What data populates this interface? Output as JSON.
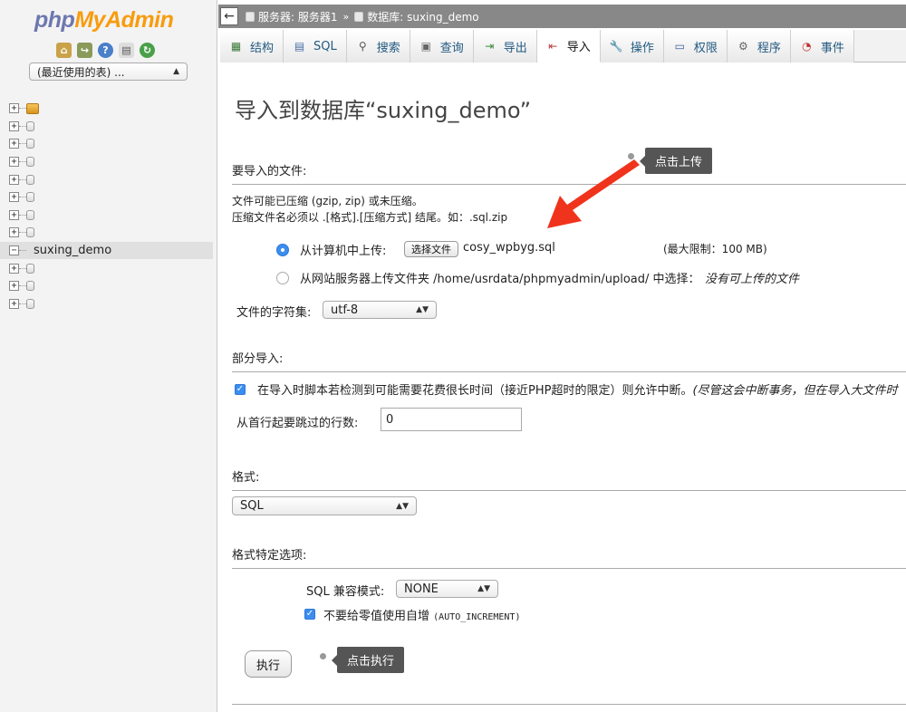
{
  "sidebar": {
    "logo": {
      "php": "php",
      "my": "My",
      "admin": "Admin"
    },
    "quick_icons": [
      "home-icon",
      "logout-icon",
      "help-icon",
      "docs-icon",
      "reload-icon"
    ],
    "recent_select": "(最近使用的表) ...",
    "databases": [
      "",
      "",
      "",
      "",
      "",
      "",
      "",
      "",
      "suxing_demo",
      "",
      "",
      ""
    ],
    "selected_db_index": 8
  },
  "topbar": {
    "server": "服务器: 服务器1",
    "database": "数据库: suxing_demo"
  },
  "tabs": [
    {
      "label": "结构",
      "icon": "structure-icon"
    },
    {
      "label": "SQL",
      "icon": "sql-icon"
    },
    {
      "label": "搜索",
      "icon": "search-icon"
    },
    {
      "label": "查询",
      "icon": "query-icon"
    },
    {
      "label": "导出",
      "icon": "export-icon"
    },
    {
      "label": "导入",
      "icon": "import-icon",
      "active": true
    },
    {
      "label": "操作",
      "icon": "wrench-icon"
    },
    {
      "label": "权限",
      "icon": "privileges-icon"
    },
    {
      "label": "程序",
      "icon": "routines-icon"
    },
    {
      "label": "事件",
      "icon": "events-icon"
    }
  ],
  "main": {
    "title": "导入到数据库“suxing_demo”",
    "file_section": {
      "title": "要导入的文件:",
      "tooltip": "点击上传",
      "note1": "文件可能已压缩 (gzip, zip) 或未压缩。",
      "note2": "压缩文件名必须以 .[格式].[压缩方式] 结尾。如：.sql.zip",
      "upload_local_label": "从计算机中上传:",
      "choose_file_button": "选择文件",
      "chosen_file": "cosy_wpbyg.sql",
      "max_size": "(最大限制：100 MB)",
      "upload_server_label": "从网站服务器上传文件夹 /home/usrdata/phpmyadmin/upload/ 中选择：",
      "no_files": "没有可上传的文件",
      "charset_label": "文件的字符集:",
      "charset_value": "utf-8"
    },
    "partial_section": {
      "title": "部分导入:",
      "interrupt_label": "在导入时脚本若检测到可能需要花费很长时间（接近PHP超时的限定）则允许中断。",
      "interrupt_note": "(尽管这会中断事务，但在导入大文件时",
      "skip_label": "从首行起要跳过的行数:",
      "skip_value": "0"
    },
    "format_section": {
      "title": "格式:",
      "format_value": "SQL"
    },
    "format_options": {
      "title": "格式特定选项:",
      "compat_label": "SQL 兼容模式:",
      "compat_value": "NONE",
      "auto_inc_label": "不要给零值使用自增",
      "auto_inc_code": "(AUTO_INCREMENT)"
    },
    "execute_button": "执行",
    "execute_tooltip": "点击执行"
  },
  "colors": {
    "arrow": "#f0331c",
    "accent": "#3b8ef0"
  }
}
